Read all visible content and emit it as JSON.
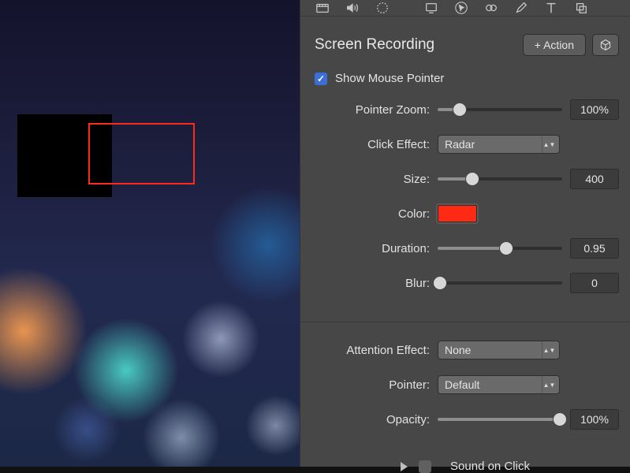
{
  "toolbar_icons": [
    "video-icon",
    "speaker-icon",
    "rotate-icon",
    "screen-icon",
    "cursor-arrow-icon",
    "link-icon",
    "pencil-icon",
    "text-icon",
    "copy-icon"
  ],
  "panel": {
    "title": "Screen Recording",
    "action_button": "+ Action",
    "cube_button_icon": "cube-icon"
  },
  "show_pointer": {
    "label": "Show Mouse Pointer",
    "checked": true
  },
  "rows": {
    "pointer_zoom": {
      "label": "Pointer Zoom:",
      "value": "100%",
      "pos": 0.18
    },
    "click_effect": {
      "label": "Click Effect:",
      "value": "Radar"
    },
    "size": {
      "label": "Size:",
      "value": "400",
      "pos": 0.28
    },
    "color": {
      "label": "Color:",
      "value": "#ff2a14"
    },
    "duration": {
      "label": "Duration:",
      "value": "0.95",
      "pos": 0.55
    },
    "blur": {
      "label": "Blur:",
      "value": "0",
      "pos": 0.02
    },
    "attention": {
      "label": "Attention Effect:",
      "value": "None"
    },
    "pointer": {
      "label": "Pointer:",
      "value": "Default"
    },
    "opacity": {
      "label": "Opacity:",
      "value": "100%",
      "pos": 0.98
    }
  },
  "sound": {
    "label": "Sound on Click",
    "checked": false
  }
}
